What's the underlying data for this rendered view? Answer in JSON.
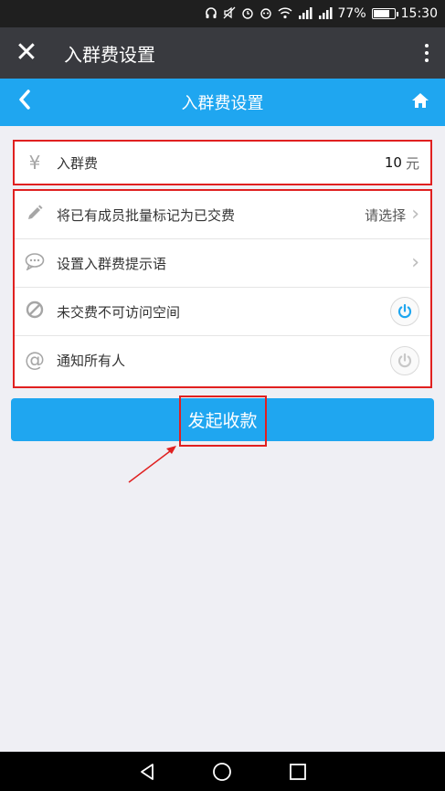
{
  "status_bar": {
    "battery": "77%",
    "time": "15:30",
    "battery_level": 0.77
  },
  "app_bar": {
    "title": "入群费设置"
  },
  "nav_bar": {
    "title": "入群费设置"
  },
  "fee": {
    "label": "入群费",
    "value": "10",
    "unit": "元"
  },
  "settings": [
    {
      "label": "将已有成员批量标记为已交费",
      "hint": "请选择"
    },
    {
      "label": "设置入群费提示语"
    },
    {
      "label": "未交费不可访问空间",
      "enabled": true
    },
    {
      "label": "通知所有人",
      "enabled": false
    }
  ],
  "primary_button": {
    "label": "发起收款"
  },
  "colors": {
    "accent": "#1fa6f0",
    "highlight": "#e02020"
  }
}
